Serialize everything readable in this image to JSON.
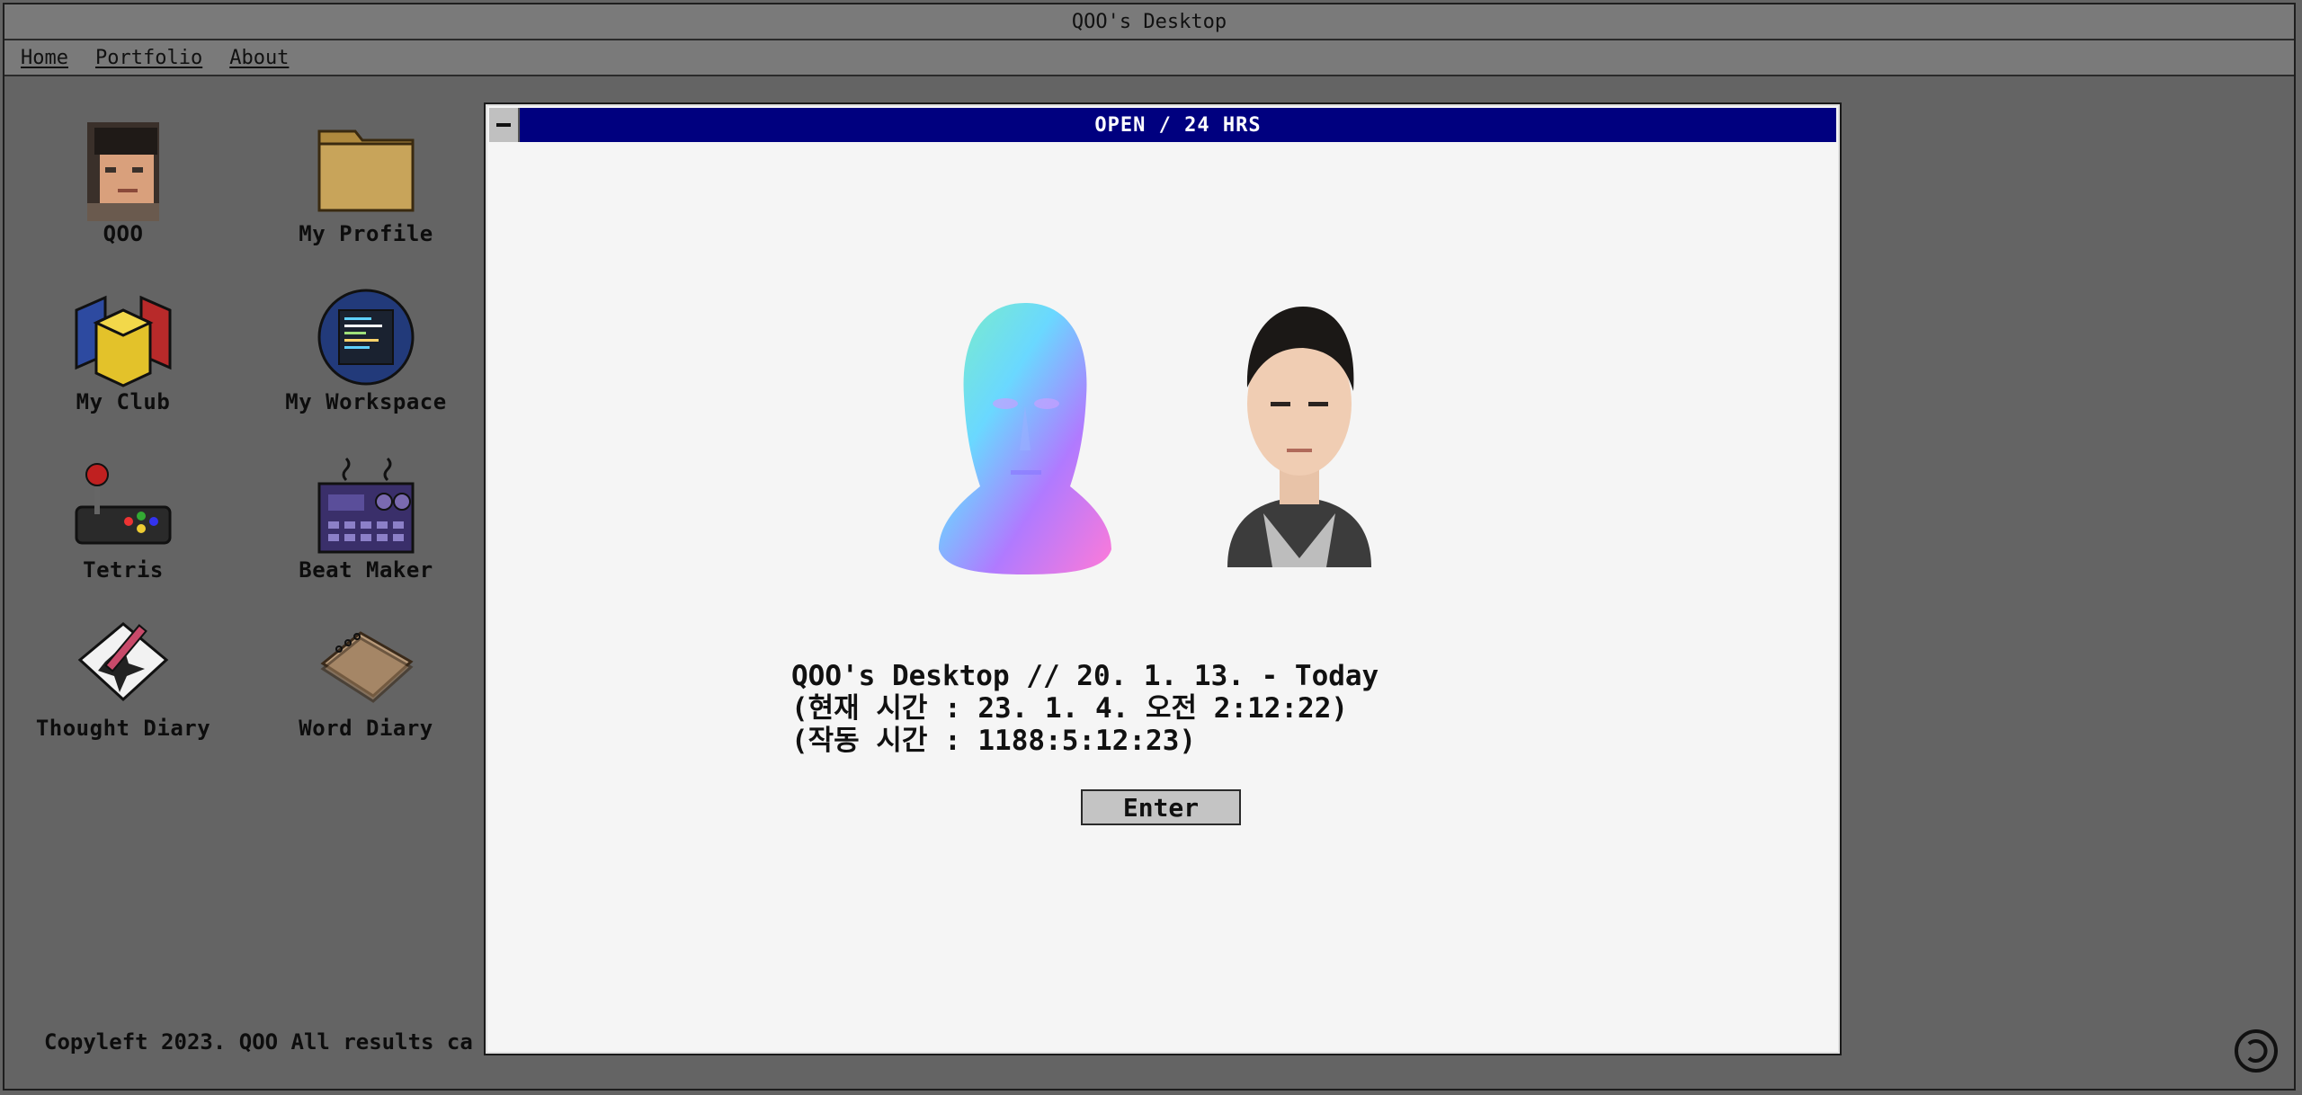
{
  "app": {
    "title": "QOO's Desktop"
  },
  "menu": [
    {
      "label": "Home"
    },
    {
      "label": "Portfolio"
    },
    {
      "label": "About"
    }
  ],
  "desktop_icons": [
    {
      "label": "QOO",
      "icon": "avatar-icon"
    },
    {
      "label": "My Profile",
      "icon": "folder-icon"
    },
    {
      "label": "My Club",
      "icon": "blocks-icon"
    },
    {
      "label": "My Workspace",
      "icon": "monitor-icon"
    },
    {
      "label": "Tetris",
      "icon": "joystick-icon"
    },
    {
      "label": "Beat Maker",
      "icon": "beat-machine-icon"
    },
    {
      "label": "Thought Diary",
      "icon": "pen-paper-icon"
    },
    {
      "label": "Word Diary",
      "icon": "notebook-icon"
    }
  ],
  "footer": {
    "text": "Copyleft 2023. QOO All results ca"
  },
  "window": {
    "title": "OPEN / 24 HRS",
    "info_lines": [
      "QOO's Desktop // 20. 1. 13. - Today",
      "(현재 시간 : 23. 1. 4. 오전 2:12:22)",
      "(작동 시간 : 1188:5:12:23)"
    ],
    "enter_label": "Enter"
  },
  "colors": {
    "desktop_bg": "#646464",
    "bar_bg": "#7a7a7a",
    "window_title_bg": "#00007f",
    "window_bg": "#f5f5f5"
  }
}
